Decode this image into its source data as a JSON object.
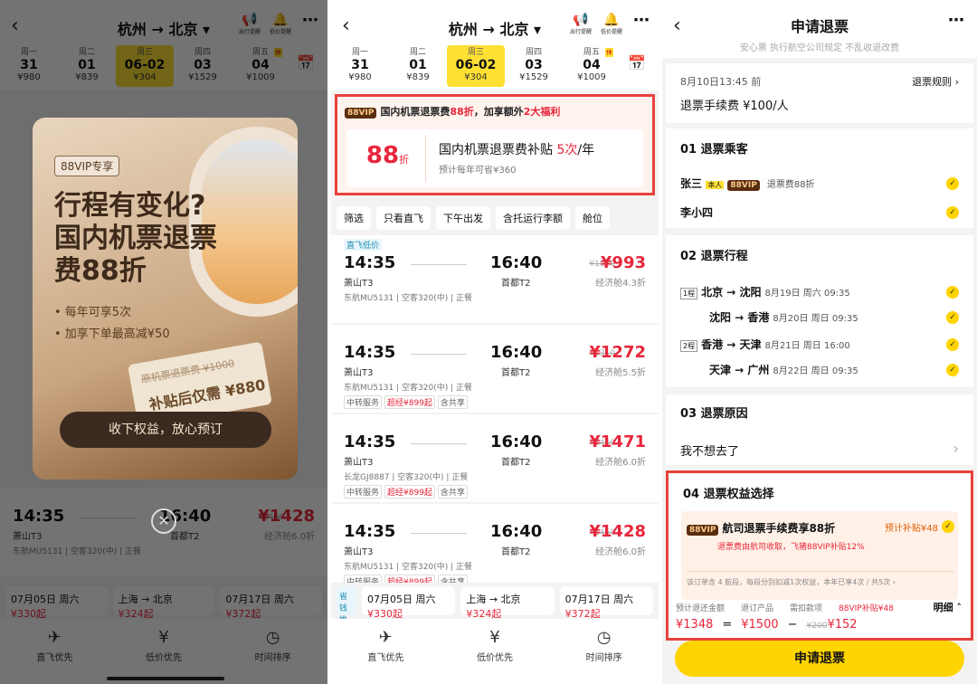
{
  "header": {
    "route": "杭州 → 北京",
    "icon_labels": [
      "出行提醒",
      "低价提醒"
    ]
  },
  "dates": [
    {
      "dow": "周一",
      "date": "31",
      "price": "¥980"
    },
    {
      "dow": "周二",
      "date": "01",
      "price": "¥839"
    },
    {
      "dow": "周三",
      "date": "06-02",
      "price": "¥304"
    },
    {
      "dow": "周四",
      "date": "03",
      "price": "¥1529"
    },
    {
      "dow": "周五",
      "date": "04",
      "price": "¥1009",
      "badge": "休"
    }
  ],
  "promo": {
    "vip": "88VIP",
    "headline_a": "国内机票退票费",
    "headline_b": "88折",
    "headline_c": "，加享额外",
    "headline_d": "2大福利",
    "discount": "88",
    "discount_unit": "折",
    "card_title_a": "国内机票退票费补贴 ",
    "card_title_b": "5次",
    "card_title_c": "/年",
    "card_sub": "预计每年可省¥360"
  },
  "filters": [
    "筛选",
    "只看直飞",
    "下午出发",
    "含托运行李额",
    "舱位"
  ],
  "flights": [
    {
      "tag": "直飞低价",
      "dep": "14:35",
      "arr": "16:40",
      "from": "萧山T3",
      "to": "首都T2",
      "orig": "¥1020",
      "price": "¥993",
      "cabin": "经济舱4.3折",
      "air": "东航MU5131 | 空客320(中) | 正餐",
      "tags": []
    },
    {
      "dep": "14:35",
      "arr": "16:40",
      "from": "萧山T3",
      "to": "首都T2",
      "orig": "¥1310",
      "price": "¥1272",
      "cabin": "经济舱5.5折",
      "air": "东航MU5131 | 空客320(中) | 正餐",
      "tags": [
        "中转服务",
        "超经¥899起",
        "含共享"
      ]
    },
    {
      "dep": "14:35",
      "arr": "16:40",
      "from": "萧山T3",
      "to": "首都T2",
      "orig": "¥1450",
      "price": "¥1471",
      "cabin": "经济舱6.0折",
      "air": "长龙GJ8887 | 空客320(中) | 正餐",
      "tags": [
        "中转服务",
        "超经¥899起",
        "含共享"
      ]
    },
    {
      "dep": "14:35",
      "arr": "16:40",
      "from": "萧山T3",
      "to": "首都T2",
      "orig": "¥1450",
      "price": "¥1428",
      "cabin": "经济舱6.0折",
      "air": "东航MU5131 | 空客320(中) | 正餐",
      "tags": [
        "中转服务",
        "超经¥899起",
        "含共享"
      ]
    }
  ],
  "strip": [
    "07月05日 周六",
    "上海 → 北京",
    "07月17日 周六"
  ],
  "strip_prices": [
    "¥330起",
    "¥324起",
    "¥372起"
  ],
  "strip_side": "省钱推",
  "nav": [
    {
      "icon": "plane-icon",
      "label": "直飞优先"
    },
    {
      "icon": "yuan-icon",
      "label": "低价优先"
    },
    {
      "icon": "clock-icon",
      "label": "时间排序"
    }
  ],
  "popup": {
    "badge": "88VIP专享",
    "title": "行程有变化?国内机票退票费88折",
    "bullet1": "• 每年可享5次",
    "bullet2": "• 加享下单最高减¥50",
    "ticket_old": "原机票退票费 ¥1000",
    "ticket_new": "补贴后仅需 ¥880",
    "button": "收下权益，放心预订"
  },
  "refund": {
    "title": "申请退票",
    "assure": "安心票  执行航空公司规定 不乱收退改费",
    "time": "8月10日13:45 前",
    "rule": "退票规则 ›",
    "fee": "退票手续费 ¥100/人",
    "sec1": "01 退票乘客",
    "p1": "张三",
    "p1_self": "本人",
    "p1_vip": "88VIP",
    "p1_note": "退票费88折",
    "p2": "李小四",
    "sec2": "02 退票行程",
    "legs": [
      {
        "seg": "1程",
        "route": "北京 → 沈阳",
        "time": "8月19日 周六 09:35"
      },
      {
        "seg": "",
        "route": "沈阳 → 香港",
        "time": "8月20日 周日 09:35"
      },
      {
        "seg": "2程",
        "route": "香港 → 天津",
        "time": "8月21日 周日 16:00"
      },
      {
        "seg": "",
        "route": "天津 → 广州",
        "time": "8月22日 周日 09:35"
      }
    ],
    "sec3": "03 退票原因",
    "reason": "我不想去了",
    "sec4": "04 退票权益选择",
    "bene_vip": "88VIP",
    "bene_title": "航司退票手续费享88折",
    "bene_est": "预计补贴¥48",
    "bene_sub": "退票费由航司收取，飞猪88VIP补贴12%",
    "bene_note": "该订单含 4 航段，每段分别扣减1次权益，本年已享4次 / 共5次 ›",
    "sum_labels": [
      "预计退还金额",
      "退订产品",
      "需扣款项",
      "88VIP补贴¥48"
    ],
    "sum_detail": "明细 ˄",
    "sum_total": "¥1348",
    "sum_eq": "=",
    "sum_prod": "¥1500",
    "sum_minus": "−",
    "sum_old": "¥200",
    "sum_fee": "¥152",
    "submit": "申请退票"
  }
}
